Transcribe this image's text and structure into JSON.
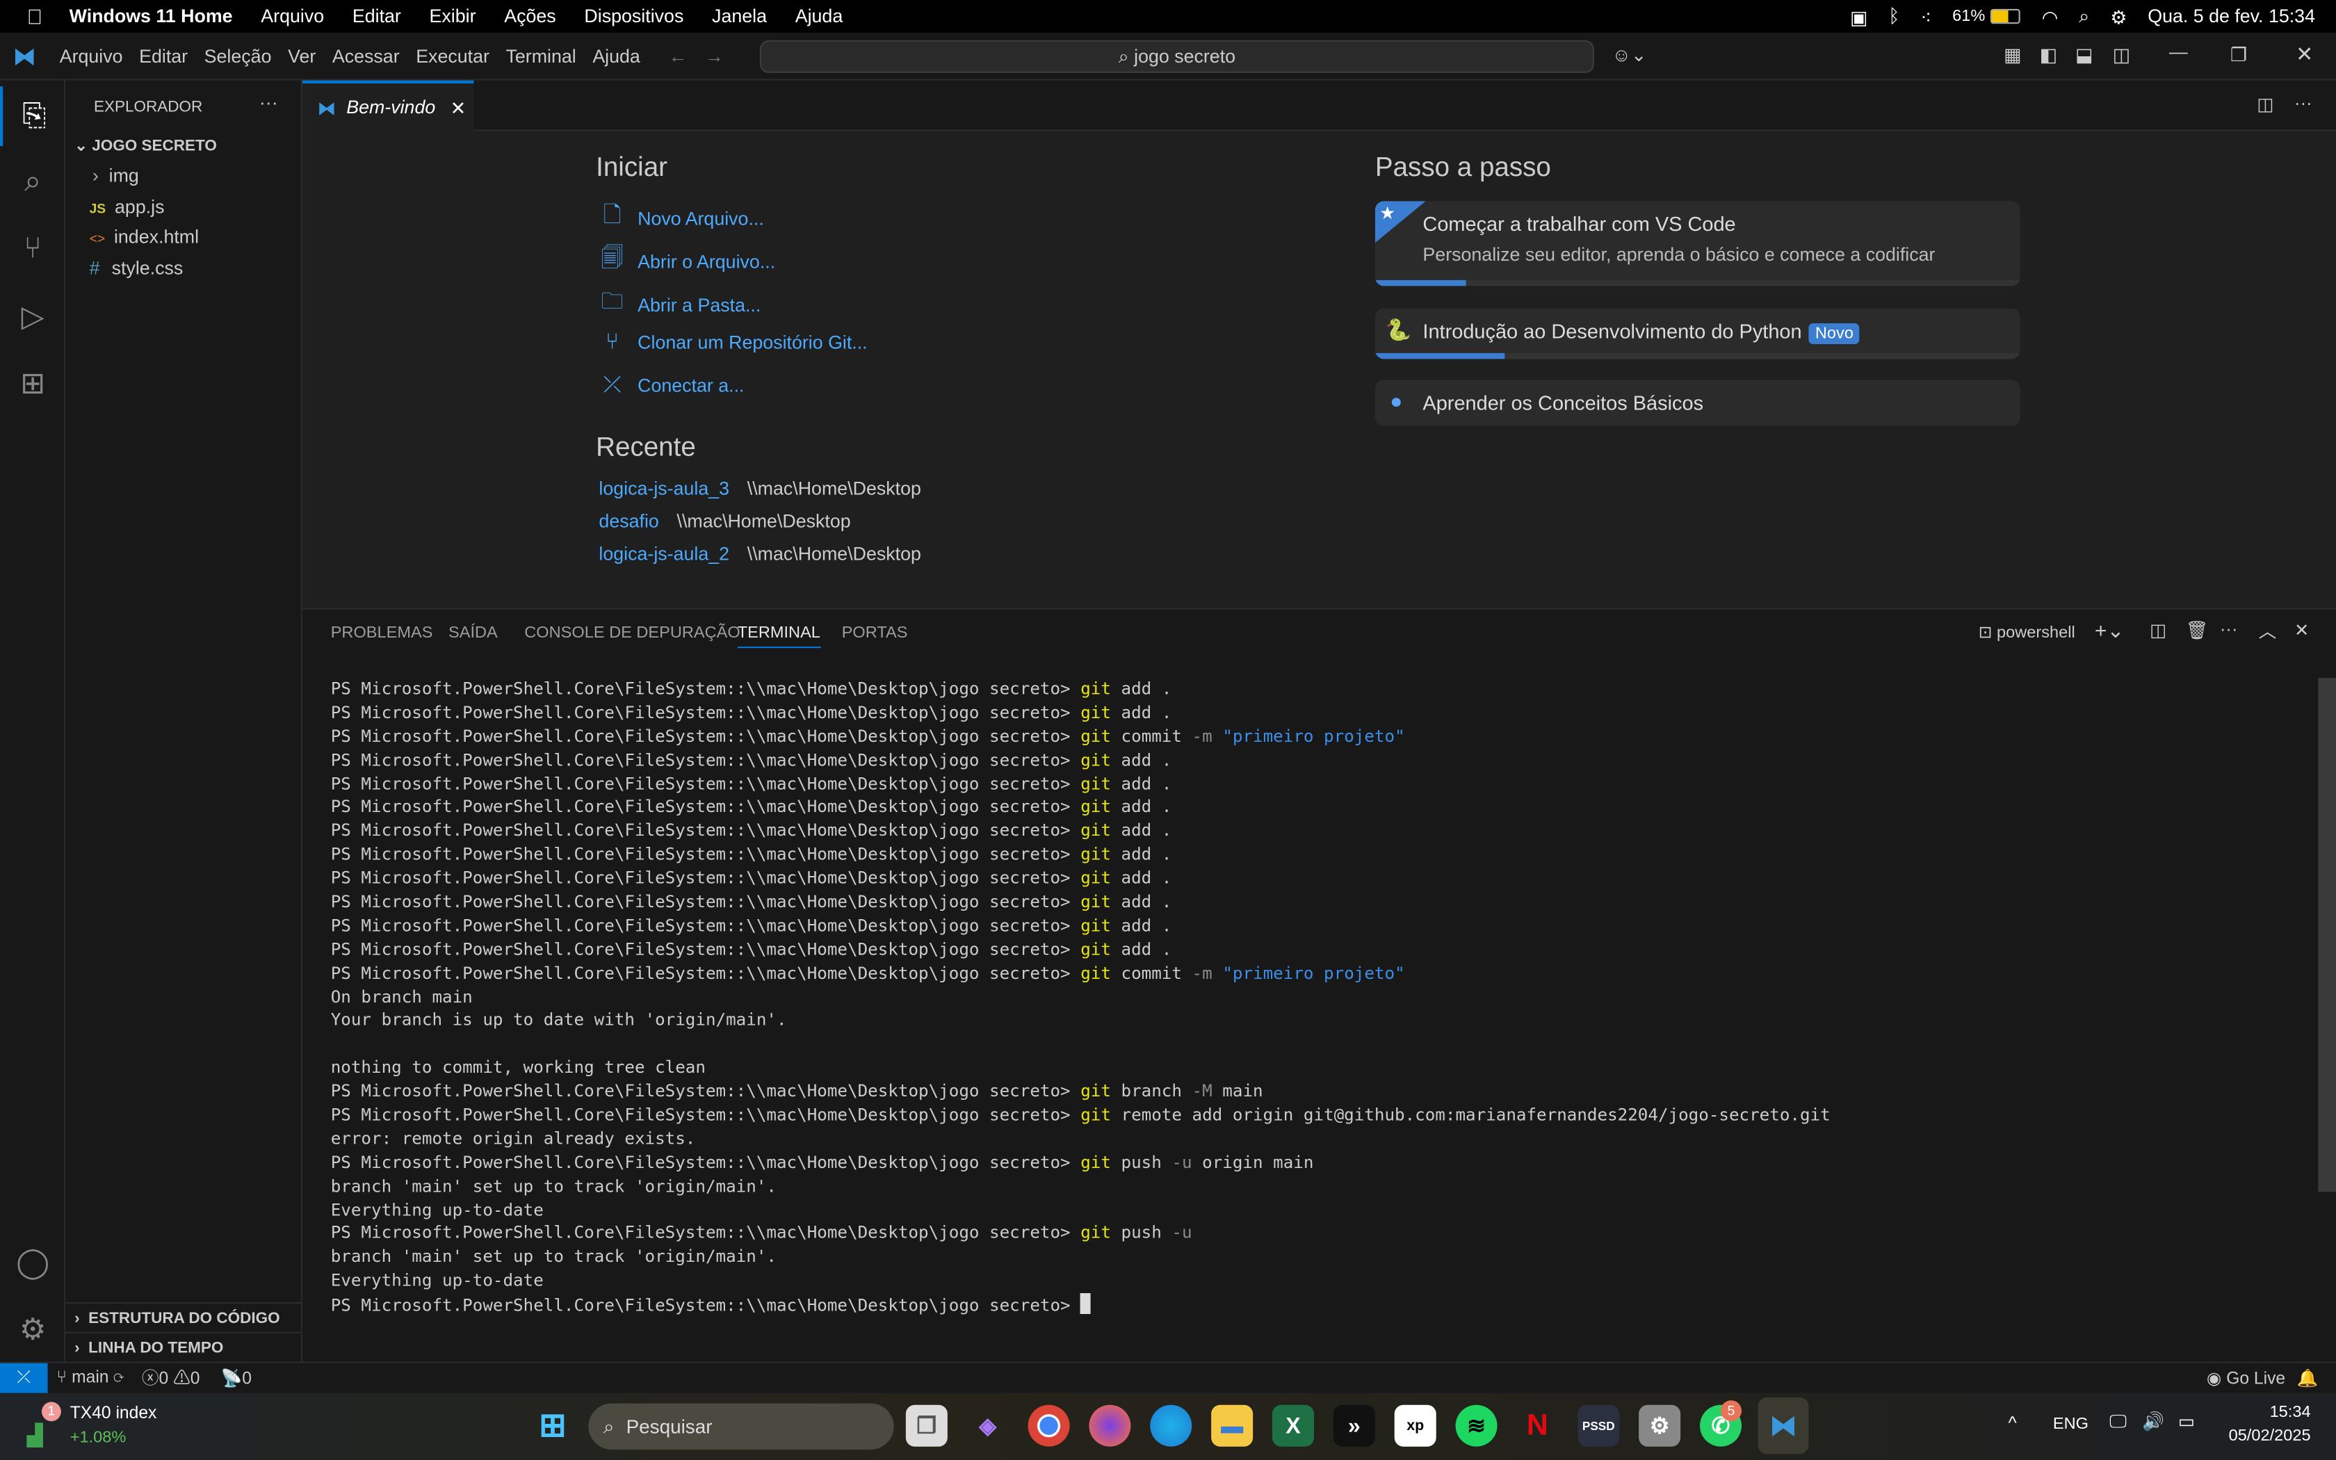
{
  "mac_menubar": {
    "app": "Windows 11 Home",
    "items": [
      "Arquivo",
      "Editar",
      "Exibir",
      "Ações",
      "Dispositivos",
      "Janela",
      "Ajuda"
    ],
    "battery": "61%",
    "datetime": "Qua. 5 de fev. 15:34"
  },
  "titlebar": {
    "menu": [
      "Arquivo",
      "Editar",
      "Seleção",
      "Ver",
      "Acessar",
      "Executar",
      "Terminal",
      "Ajuda"
    ],
    "search": "jogo secreto"
  },
  "sidebar": {
    "title": "EXPLORADOR",
    "folder": "JOGO SECRETO",
    "items": [
      {
        "label": "img",
        "icon": ">"
      },
      {
        "label": "app.js",
        "icon": "JS"
      },
      {
        "label": "index.html",
        "icon": "<>"
      },
      {
        "label": "style.css",
        "icon": "#"
      }
    ],
    "outline": "ESTRUTURA DO CÓDIGO",
    "timeline": "LINHA DO TEMPO"
  },
  "tab": {
    "label": "Bem-vindo"
  },
  "welcome": {
    "start_title": "Iniciar",
    "start": [
      {
        "label": "Novo Arquivo...",
        "icon": "new-file-icon"
      },
      {
        "label": "Abrir o Arquivo...",
        "icon": "open-file-icon"
      },
      {
        "label": "Abrir a Pasta...",
        "icon": "folder-icon"
      },
      {
        "label": "Clonar um Repositório Git...",
        "icon": "git-icon"
      },
      {
        "label": "Conectar a...",
        "icon": "remote-icon"
      }
    ],
    "recent_title": "Recente",
    "recent": [
      {
        "name": "logica-js-aula_3",
        "path": "\\\\mac\\Home\\Desktop"
      },
      {
        "name": "desafio",
        "path": "\\\\mac\\Home\\Desktop"
      },
      {
        "name": "logica-js-aula_2",
        "path": "\\\\mac\\Home\\Desktop"
      }
    ],
    "walk_title": "Passo a passo",
    "walk": [
      {
        "title": "Começar a trabalhar com VS Code",
        "desc": "Personalize seu editor, aprenda o básico e comece a codificar",
        "progress": 0.14
      },
      {
        "title": "Introdução ao Desenvolvimento do Python",
        "badge": "Novo",
        "progress": 0.2
      },
      {
        "title": "Aprender os Conceitos Básicos"
      }
    ]
  },
  "panel": {
    "tabs": [
      "PROBLEMAS",
      "SAÍDA",
      "CONSOLE DE DEPURAÇÃO",
      "TERMINAL",
      "PORTAS"
    ],
    "active": "TERMINAL",
    "shell": "powershell"
  },
  "terminal": {
    "prompt": "PS Microsoft.PowerShell.Core\\FileSystem::\\\\mac\\Home\\Desktop\\jogo secreto> ",
    "lines": [
      {
        "p": 1,
        "tokens": [
          [
            "git",
            "cmd"
          ],
          [
            " add .",
            ""
          ]
        ]
      },
      {
        "p": 1,
        "tokens": [
          [
            "git",
            "cmd"
          ],
          [
            " add .",
            ""
          ]
        ]
      },
      {
        "p": 1,
        "tokens": [
          [
            "git",
            "cmd"
          ],
          [
            " commit ",
            ""
          ],
          [
            "-m",
            "flag"
          ],
          [
            " ",
            ""
          ],
          [
            "\"primeiro projeto\"",
            "str"
          ]
        ]
      },
      {
        "p": 1,
        "tokens": [
          [
            "git",
            "cmd"
          ],
          [
            " add .",
            ""
          ]
        ]
      },
      {
        "p": 1,
        "tokens": [
          [
            "git",
            "cmd"
          ],
          [
            " add .",
            ""
          ]
        ]
      },
      {
        "p": 1,
        "tokens": [
          [
            "git",
            "cmd"
          ],
          [
            " add .",
            ""
          ]
        ]
      },
      {
        "p": 1,
        "tokens": [
          [
            "git",
            "cmd"
          ],
          [
            " add .",
            ""
          ]
        ]
      },
      {
        "p": 1,
        "tokens": [
          [
            "git",
            "cmd"
          ],
          [
            " add .",
            ""
          ]
        ]
      },
      {
        "p": 1,
        "tokens": [
          [
            "git",
            "cmd"
          ],
          [
            " add .",
            ""
          ]
        ]
      },
      {
        "p": 1,
        "tokens": [
          [
            "git",
            "cmd"
          ],
          [
            " add .",
            ""
          ]
        ]
      },
      {
        "p": 1,
        "tokens": [
          [
            "git",
            "cmd"
          ],
          [
            " add .",
            ""
          ]
        ]
      },
      {
        "p": 1,
        "tokens": [
          [
            "git",
            "cmd"
          ],
          [
            " add .",
            ""
          ]
        ]
      },
      {
        "p": 1,
        "tokens": [
          [
            "git",
            "cmd"
          ],
          [
            " commit ",
            ""
          ],
          [
            "-m",
            "flag"
          ],
          [
            " ",
            ""
          ],
          [
            "\"primeiro projeto\"",
            "str"
          ]
        ]
      },
      {
        "p": 0,
        "tokens": [
          [
            "On branch main",
            ""
          ]
        ]
      },
      {
        "p": 0,
        "tokens": [
          [
            "Your branch is up to date with 'origin/main'.",
            ""
          ]
        ]
      },
      {
        "p": 0,
        "tokens": [
          [
            "",
            ""
          ]
        ]
      },
      {
        "p": 0,
        "tokens": [
          [
            "nothing to commit, working tree clean",
            ""
          ]
        ]
      },
      {
        "p": 1,
        "tokens": [
          [
            "git",
            "cmd"
          ],
          [
            " branch ",
            ""
          ],
          [
            "-M",
            "flag"
          ],
          [
            " main",
            ""
          ]
        ]
      },
      {
        "p": 1,
        "tokens": [
          [
            "git",
            "cmd"
          ],
          [
            " remote add origin git@github.com:marianafernandes2204/jogo-secreto.git",
            ""
          ]
        ]
      },
      {
        "p": 0,
        "tokens": [
          [
            "error: remote origin already exists.",
            ""
          ]
        ]
      },
      {
        "p": 1,
        "tokens": [
          [
            "git",
            "cmd"
          ],
          [
            " push ",
            ""
          ],
          [
            "-u",
            "flag"
          ],
          [
            " origin main",
            ""
          ]
        ]
      },
      {
        "p": 0,
        "tokens": [
          [
            "branch 'main' set up to track 'origin/main'.",
            ""
          ]
        ]
      },
      {
        "p": 0,
        "tokens": [
          [
            "Everything up-to-date",
            ""
          ]
        ]
      },
      {
        "p": 1,
        "tokens": [
          [
            "git",
            "cmd"
          ],
          [
            " push ",
            ""
          ],
          [
            "-u",
            "flag"
          ]
        ]
      },
      {
        "p": 0,
        "tokens": [
          [
            "branch 'main' set up to track 'origin/main'.",
            ""
          ]
        ]
      },
      {
        "p": 0,
        "tokens": [
          [
            "Everything up-to-date",
            ""
          ]
        ]
      },
      {
        "p": 1,
        "cursor": true,
        "tokens": []
      }
    ]
  },
  "status": {
    "branch": "main",
    "errors": "0",
    "warnings": "0",
    "ports": "0",
    "golive": "Go Live"
  },
  "taskbar": {
    "widget_title": "TX40 index",
    "widget_value": "+1.08%",
    "widget_badge": "1",
    "search": "Pesquisar",
    "whatsapp_badge": "5",
    "lang": "ENG",
    "time": "15:34",
    "date": "05/02/2025"
  },
  "colors": {
    "accent": "#0078d4",
    "link": "#4daafc",
    "git_cmd": "#e5e510"
  }
}
